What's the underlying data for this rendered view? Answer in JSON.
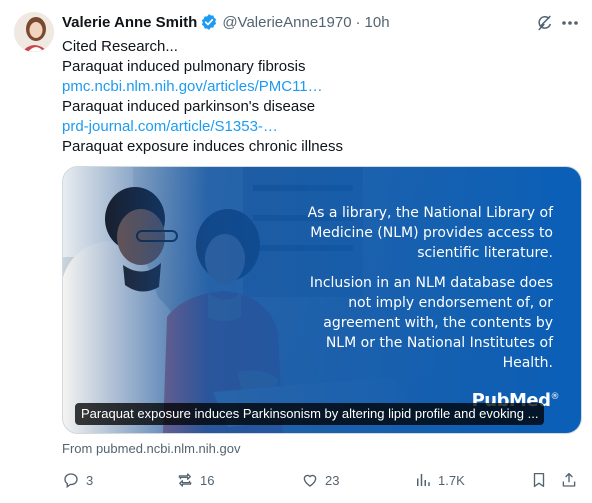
{
  "author": {
    "display_name": "Valerie Anne Smith",
    "handle": "@ValerieAnne1970",
    "separator": "·",
    "time": "10h",
    "verified_icon": "verified-badge-icon"
  },
  "tweet": {
    "lines": [
      {
        "text": "Cited Research...",
        "type": "text"
      },
      {
        "text": "Paraquat induced pulmonary fibrosis",
        "type": "text"
      },
      {
        "text": "pmc.ncbi.nlm.nih.gov/articles/PMC11…",
        "type": "link"
      },
      {
        "text": "Paraquat induced parkinson's disease",
        "type": "text"
      },
      {
        "text": "prd-journal.com/article/S1353-…",
        "type": "link"
      },
      {
        "text": "Paraquat exposure induces chronic illness",
        "type": "text"
      }
    ]
  },
  "card": {
    "overlay_paragraph_1": "As a library, the National Library of Medicine (NLM) provides access to scientific literature.",
    "overlay_paragraph_2": "Inclusion in an NLM database does not imply endorsement of, or agreement with, the contents by NLM or the National Institutes of Health.",
    "logo_text": "PubMed",
    "logo_mark": "®",
    "title": "Paraquat exposure induces Parkinsonism by altering lipid profile and evoking ...",
    "source": "From pubmed.ncbi.nlm.nih.gov"
  },
  "actions": {
    "replies": "3",
    "reposts": "16",
    "likes": "23",
    "views": "1.7K"
  },
  "colors": {
    "link": "#1d9bf0",
    "secondary_text": "#536471",
    "card_blue": "#0a55a6",
    "verified_blue": "#1d9bf0"
  },
  "icons": [
    "grok-icon",
    "more-icon",
    "reply-icon",
    "repost-icon",
    "like-icon",
    "views-icon",
    "bookmark-icon",
    "share-icon"
  ]
}
